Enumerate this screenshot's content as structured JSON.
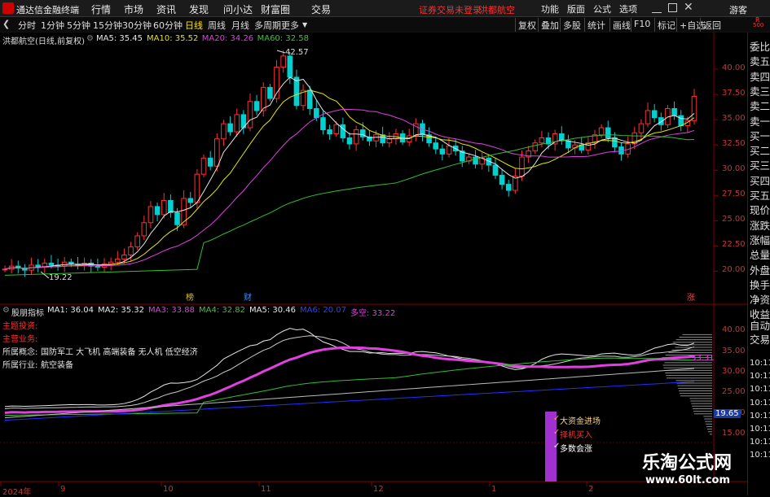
{
  "app": {
    "title": "通达信金融终端",
    "menu": [
      "行情",
      "市场",
      "资讯",
      "发现",
      "问小达",
      "财富圈",
      "交易"
    ],
    "notice": "证券交易未登录",
    "stock": "洪都航空",
    "right_menu": [
      "功能",
      "版面",
      "公式",
      "选项"
    ],
    "guest": "游客"
  },
  "toolbar": {
    "periods": [
      "分时",
      "1分钟",
      "5分钟",
      "15分钟",
      "30分钟",
      "60分钟",
      "日线",
      "周线",
      "月线",
      "多周期",
      "更多"
    ],
    "active_period": "日线",
    "right": [
      "复权",
      "叠加",
      "多股",
      "统计",
      "画线",
      "F10",
      "标记",
      "+自选",
      "返回"
    ]
  },
  "main": {
    "title": "洪都航空(日线,前复权)",
    "ma_labels": [
      {
        "t": "MA5: 35.45",
        "c": "#e6e6e6"
      },
      {
        "t": "MA10: 35.52",
        "c": "#e6e600"
      },
      {
        "t": "MA20: 34.26",
        "c": "#e040e0"
      },
      {
        "t": "MA60: 32.58",
        "c": "#40c040"
      }
    ],
    "high_mark": "42.57",
    "low_mark": "19.22",
    "y_ticks": [
      "40.00",
      "37.50",
      "35.00",
      "32.50",
      "30.00",
      "27.50",
      "25.00",
      "22.50",
      "20.00"
    ],
    "markers": [
      {
        "t": "榜",
        "c": "#e0c000"
      },
      {
        "t": "财",
        "c": "#4090ff"
      },
      {
        "t": "涨",
        "c": "#ff4040"
      }
    ]
  },
  "indicator": {
    "title": "股朋指标",
    "labels": [
      {
        "t": "MA1: 36.04",
        "c": "#e6e6e6"
      },
      {
        "t": "MA2: 35.32",
        "c": "#e6e6e6"
      },
      {
        "t": "MA3: 33.88",
        "c": "#e040e0"
      },
      {
        "t": "MA4: 32.82",
        "c": "#40c040"
      },
      {
        "t": "MA5: 30.46",
        "c": "#e6e6e6"
      },
      {
        "t": "MA6: 20.07",
        "c": "#3040ff"
      },
      {
        "t": "多空: 33.22",
        "c": "#e040e0"
      }
    ],
    "info": [
      {
        "k": "主题投资:",
        "v": "",
        "c": "#ff3030"
      },
      {
        "k": "主营业务:",
        "v": "",
        "c": "#ff3030"
      },
      {
        "k": "所属概念:",
        "v": "国防军工 大飞机 高端装备 无人机 低空经济",
        "c": "#e6e6e6"
      },
      {
        "k": "所属行业:",
        "v": "航空装备",
        "c": "#e6e6e6"
      }
    ],
    "y_ticks": [
      "40.00",
      "35.00",
      "30.00",
      "25.00",
      "20.00",
      "15.00"
    ],
    "price_tag": "19.65",
    "mid_tag": "33.31",
    "signals": [
      "大资金进场",
      "择机买入",
      "多数会涨"
    ]
  },
  "xaxis": [
    "2024年",
    "9",
    "10",
    "11",
    "12",
    "1",
    "2"
  ],
  "side": [
    "委比",
    "卖五",
    "卖四",
    "卖三",
    "卖二",
    "卖一",
    "买一",
    "买二",
    "买三",
    "买四",
    "买五",
    "现价",
    "涨跌",
    "涨幅",
    "总量",
    "外盘",
    "换手",
    "净资",
    "收益",
    "自动",
    "交易",
    "10:11",
    "10:11",
    "10:11",
    "10:11",
    "10:11",
    "10:11",
    "10:11",
    "10:11"
  ],
  "watermark": {
    "cn": "乐淘公式网",
    "url": "www.60lt.com"
  },
  "colors": {
    "up": "#ff3030",
    "down": "#00d0d0",
    "ma5": "#e6e6e6",
    "ma10": "#e6e600",
    "ma20": "#e040e0",
    "ma60": "#30c030",
    "blue": "#2030ff"
  },
  "chart_data": {
    "type": "candlestick",
    "y_range": [
      18.5,
      42.5
    ],
    "close": [
      20.2,
      20.5,
      20.3,
      20.1,
      20.6,
      20.4,
      20.8,
      20.6,
      20.5,
      20.9,
      20.7,
      20.6,
      20.8,
      20.5,
      20.4,
      20.7,
      20.9,
      21.2,
      21.6,
      22.4,
      23.5,
      24.8,
      26.4,
      25.6,
      27.0,
      25.8,
      24.6,
      27.2,
      26.8,
      29.6,
      31.2,
      30.4,
      33.1,
      34.6,
      33.8,
      35.5,
      34.2,
      36.8,
      35.9,
      38.2,
      37.1,
      40.2,
      41.3,
      39.2,
      36.4,
      37.9,
      36.1,
      35.2,
      34.0,
      33.6,
      34.5,
      33.2,
      32.6,
      34.0,
      33.3,
      32.9,
      33.5,
      32.7,
      33.1,
      33.6,
      32.8,
      33.4,
      34.6,
      33.5,
      32.7,
      32.1,
      31.6,
      32.4,
      31.9,
      30.9,
      31.3,
      30.6,
      31.2,
      30.5,
      29.5,
      28.6,
      28.0,
      29.4,
      31.3,
      31.9,
      32.7,
      33.2,
      32.6,
      33.6,
      32.9,
      32.2,
      32.5,
      32.0,
      32.7,
      33.5,
      34.2,
      33.2,
      32.3,
      31.6,
      32.6,
      33.7,
      34.6,
      35.9,
      35.2,
      34.5,
      36.1,
      35.4,
      34.4,
      34.9,
      37.3
    ]
  }
}
